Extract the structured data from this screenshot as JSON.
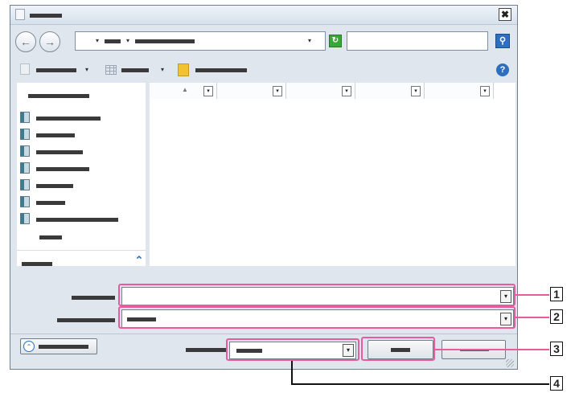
{
  "dialog": {
    "close_glyph": "✖",
    "back_glyph": "←",
    "forward_glyph": "→",
    "refresh_glyph": "↻",
    "search_glyph": "⚲",
    "help_glyph": "?",
    "collapse_glyph": "⌃",
    "expand_glyph": "⌃",
    "sort_glyph": "▲",
    "dropdown_glyph": "▾",
    "column_dropdown_glyph": "▾"
  },
  "callouts": [
    "1",
    "2",
    "3",
    "4"
  ],
  "colors": {
    "callout": "#e65c9c",
    "window_bg": "#dfe6ee",
    "accent_blue": "#2f6fbe",
    "refresh_green": "#3aa63a",
    "folder_yellow": "#f2c230"
  },
  "icons": [
    "back-icon",
    "forward-icon",
    "refresh-icon",
    "search-icon",
    "help-icon",
    "organize-icon",
    "view-icon",
    "new-folder-icon",
    "library-icon",
    "expand-icon"
  ]
}
